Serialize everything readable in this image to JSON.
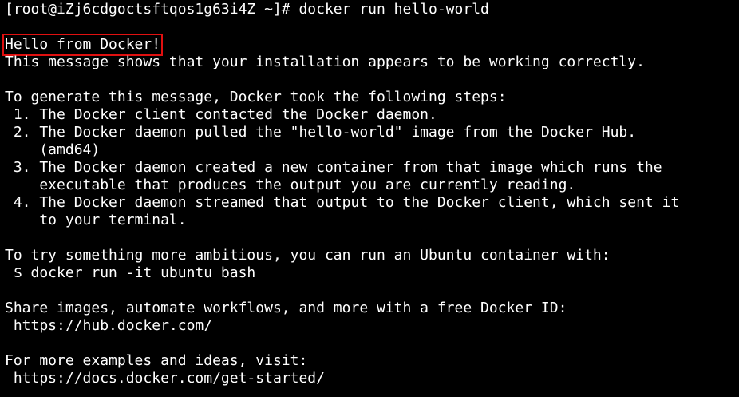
{
  "terminal": {
    "prompt_line": "[root@iZj6cdgoctsftqos1g63i4Z ~]# docker run hello-world",
    "highlight_color": "#e01010",
    "lines": [
      "",
      "Hello from Docker!",
      "This message shows that your installation appears to be working correctly.",
      "",
      "To generate this message, Docker took the following steps:",
      " 1. The Docker client contacted the Docker daemon.",
      " 2. The Docker daemon pulled the \"hello-world\" image from the Docker Hub.",
      "    (amd64)",
      " 3. The Docker daemon created a new container from that image which runs the",
      "    executable that produces the output you are currently reading.",
      " 4. The Docker daemon streamed that output to the Docker client, which sent it",
      "    to your terminal.",
      "",
      "To try something more ambitious, you can run an Ubuntu container with:",
      " $ docker run -it ubuntu bash",
      "",
      "Share images, automate workflows, and more with a free Docker ID:",
      " https://hub.docker.com/",
      "",
      "For more examples and ideas, visit:",
      " https://docs.docker.com/get-started/"
    ]
  }
}
